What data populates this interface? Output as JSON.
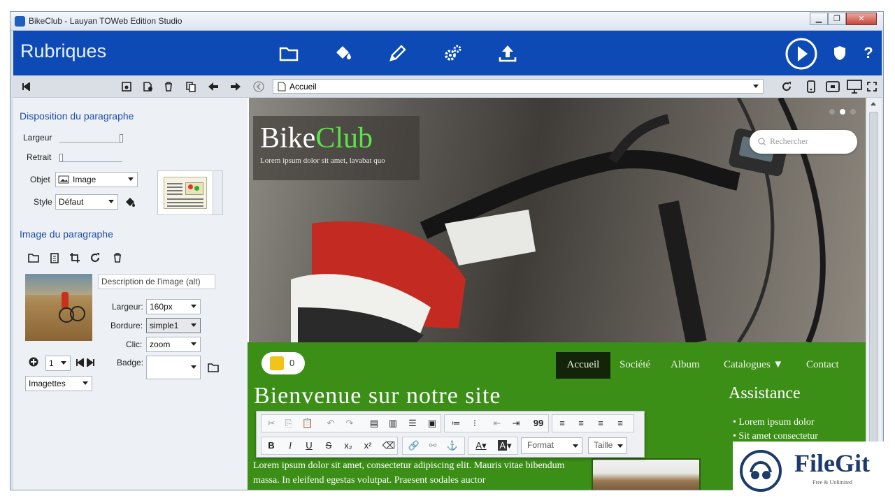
{
  "window": {
    "title": "BikeClub - Lauyan TOWeb Edition Studio",
    "buttons": [
      "▁",
      "❐",
      "✕"
    ]
  },
  "header": {
    "title": "Rubriques",
    "tools": [
      "folder-icon",
      "paint-bucket-icon",
      "pencil-icon",
      "gears-icon",
      "upload-icon"
    ],
    "right_tools": [
      "play-icon",
      "shield-icon",
      "help-icon"
    ],
    "help_label": "?"
  },
  "left_panel": {
    "section1": {
      "title": "Disposition du paragraphe",
      "largeur_label": "Largeur",
      "retrait_label": "Retrait",
      "objet_label": "Objet",
      "objet_value": "Image",
      "style_label": "Style",
      "style_value": "Défaut"
    },
    "section2": {
      "title": "Image du paragraphe",
      "alt_placeholder": "Description de l'image (alt)",
      "largeur_label": "Largeur:",
      "largeur_value": "160px",
      "bordure_label": "Bordure:",
      "bordure_value": "simple1",
      "clic_label": "Clic:",
      "clic_value": "zoom",
      "badge_label": "Badge:",
      "badge_value": "",
      "count_value": "1",
      "mode_value": "Imagettes"
    }
  },
  "right_panel": {
    "address": "Accueil",
    "site": {
      "brand_first": "Bike",
      "brand_second": "Club",
      "tagline": "Lorem ipsum dolor sit amet, lavabat quo",
      "search_placeholder": "Rechercher",
      "cart_count": "0",
      "nav": [
        "Accueil",
        "Société",
        "Album",
        "Catalogues ▼",
        "Contact"
      ],
      "heading": "Bienvenue sur notre site",
      "body": "Lorem ipsum dolor sit amet, consectetur adipiscing elit. Mauris vitae bibendum massa. In eleifend egestas volutpat. Praesent sodales auctor",
      "sidebar_title": "Assistance",
      "sidebar_items": [
        "Lorem ipsum dolor",
        "Sit amet consectetur"
      ]
    },
    "editor": {
      "format_label": "Format",
      "size_label": "Taille",
      "bold": "B",
      "italic": "I",
      "underline": "U",
      "strike": "S",
      "sub": "x₂",
      "sup": "x²",
      "quote": "99",
      "font_color": "A",
      "bg_color": "A"
    }
  },
  "watermark": {
    "text": "FileGit",
    "subtext": "Free & Unlimited"
  },
  "colors": {
    "header_blue": "#0e4ab5",
    "site_green": "#3b8e16",
    "brand_green": "#5be34a"
  }
}
